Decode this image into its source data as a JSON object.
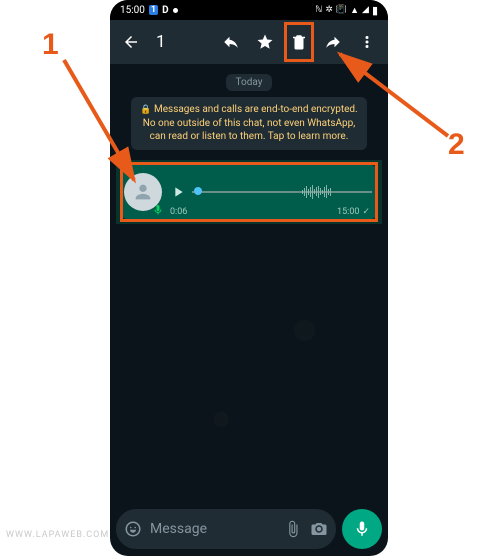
{
  "statusbar": {
    "time": "15:00",
    "bt_badge": "1",
    "d_badge": "D"
  },
  "topbar": {
    "selected_count": "1"
  },
  "chat": {
    "date_label": "Today",
    "encryption_notice": "Messages and calls are end-to-end encrypted. No one outside of this chat, not even WhatsApp, can read or listen to them. Tap to learn more.",
    "audio": {
      "elapsed": "0:06",
      "timestamp": "15:00"
    }
  },
  "input": {
    "placeholder": "Message"
  },
  "annotations": {
    "num1": "1",
    "num2": "2"
  },
  "watermark": "WWW.LAPAWEB.COM"
}
